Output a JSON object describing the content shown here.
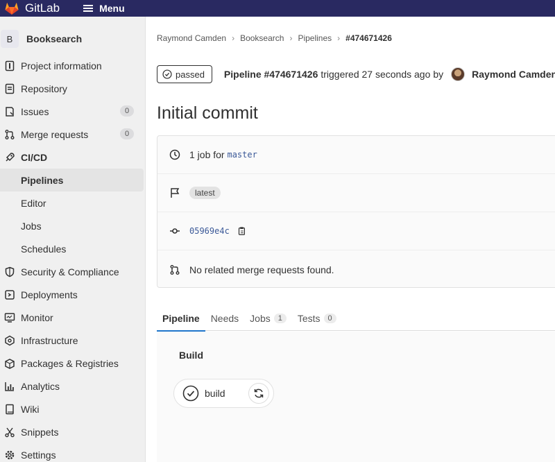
{
  "topbar": {
    "brand": "GitLab",
    "menu_label": "Menu"
  },
  "sidebar": {
    "project": {
      "avatar_letter": "B",
      "name": "Booksearch"
    },
    "items": [
      {
        "label": "Project information",
        "icon": "project-info-icon"
      },
      {
        "label": "Repository",
        "icon": "repository-icon"
      },
      {
        "label": "Issues",
        "icon": "issues-icon",
        "count": "0"
      },
      {
        "label": "Merge requests",
        "icon": "merge-request-icon",
        "count": "0"
      },
      {
        "label": "CI/CD",
        "icon": "rocket-icon"
      },
      {
        "label": "Pipelines",
        "active": true
      },
      {
        "label": "Editor"
      },
      {
        "label": "Jobs"
      },
      {
        "label": "Schedules"
      },
      {
        "label": "Security & Compliance",
        "icon": "shield-icon"
      },
      {
        "label": "Deployments",
        "icon": "deployments-icon"
      },
      {
        "label": "Monitor",
        "icon": "monitor-icon"
      },
      {
        "label": "Infrastructure",
        "icon": "infrastructure-icon"
      },
      {
        "label": "Packages & Registries",
        "icon": "package-icon"
      },
      {
        "label": "Analytics",
        "icon": "analytics-icon"
      },
      {
        "label": "Wiki",
        "icon": "wiki-icon"
      },
      {
        "label": "Snippets",
        "icon": "snippets-icon"
      },
      {
        "label": "Settings",
        "icon": "settings-icon"
      }
    ]
  },
  "breadcrumbs": [
    "Raymond Camden",
    "Booksearch",
    "Pipelines",
    "#474671426"
  ],
  "header": {
    "status": "passed",
    "pipeline_label": "Pipeline #474671426",
    "triggered": "triggered 27 seconds ago",
    "by": "by",
    "user": "Raymond Camden"
  },
  "commit_title": "Initial commit",
  "info": {
    "jobs_prefix": "1 job for",
    "branch": "master",
    "tag": "latest",
    "sha": "05969e4c",
    "merge_requests": "No related merge requests found."
  },
  "tabs": [
    {
      "label": "Pipeline",
      "active": true
    },
    {
      "label": "Needs"
    },
    {
      "label": "Jobs",
      "count": "1"
    },
    {
      "label": "Tests",
      "count": "0"
    }
  ],
  "graph": {
    "stage": "Build",
    "job": "build"
  },
  "colors": {
    "topbar": "#292961",
    "active_tab": "#1f75cb",
    "sidebar": "#f0f0f0"
  }
}
